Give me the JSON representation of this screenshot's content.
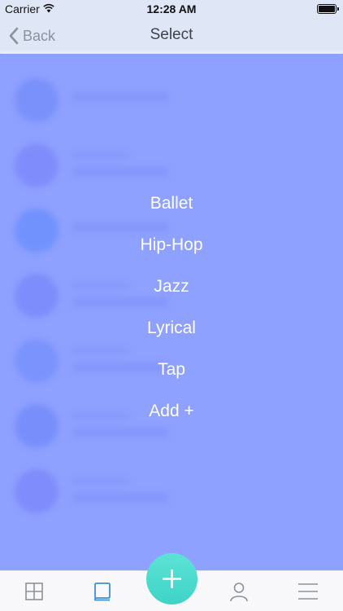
{
  "status_bar": {
    "carrier": "Carrier",
    "time": "12:28 AM",
    "icons": [
      "wifi-icon",
      "battery-icon"
    ]
  },
  "nav": {
    "back_label": "Back",
    "title": "Select",
    "back_icon": "chevron-left-icon"
  },
  "options": [
    {
      "label": "Ballet"
    },
    {
      "label": "Hip-Hop"
    },
    {
      "label": "Jazz"
    },
    {
      "label": "Lyrical"
    },
    {
      "label": "Tap"
    },
    {
      "label": "Add +"
    }
  ],
  "tab_bar": {
    "tabs": [
      {
        "icon": "grid-icon"
      },
      {
        "icon": "book-icon",
        "active": true
      },
      {
        "icon": "person-icon"
      },
      {
        "icon": "menu-icon"
      }
    ],
    "fab_icon": "plus-icon"
  },
  "colors": {
    "overlay": "#768cff",
    "header": "#dfe6f5",
    "fab": "#4fdbcf",
    "active_tab": "#3d8fd6",
    "inactive_tab": "#8e9197"
  }
}
